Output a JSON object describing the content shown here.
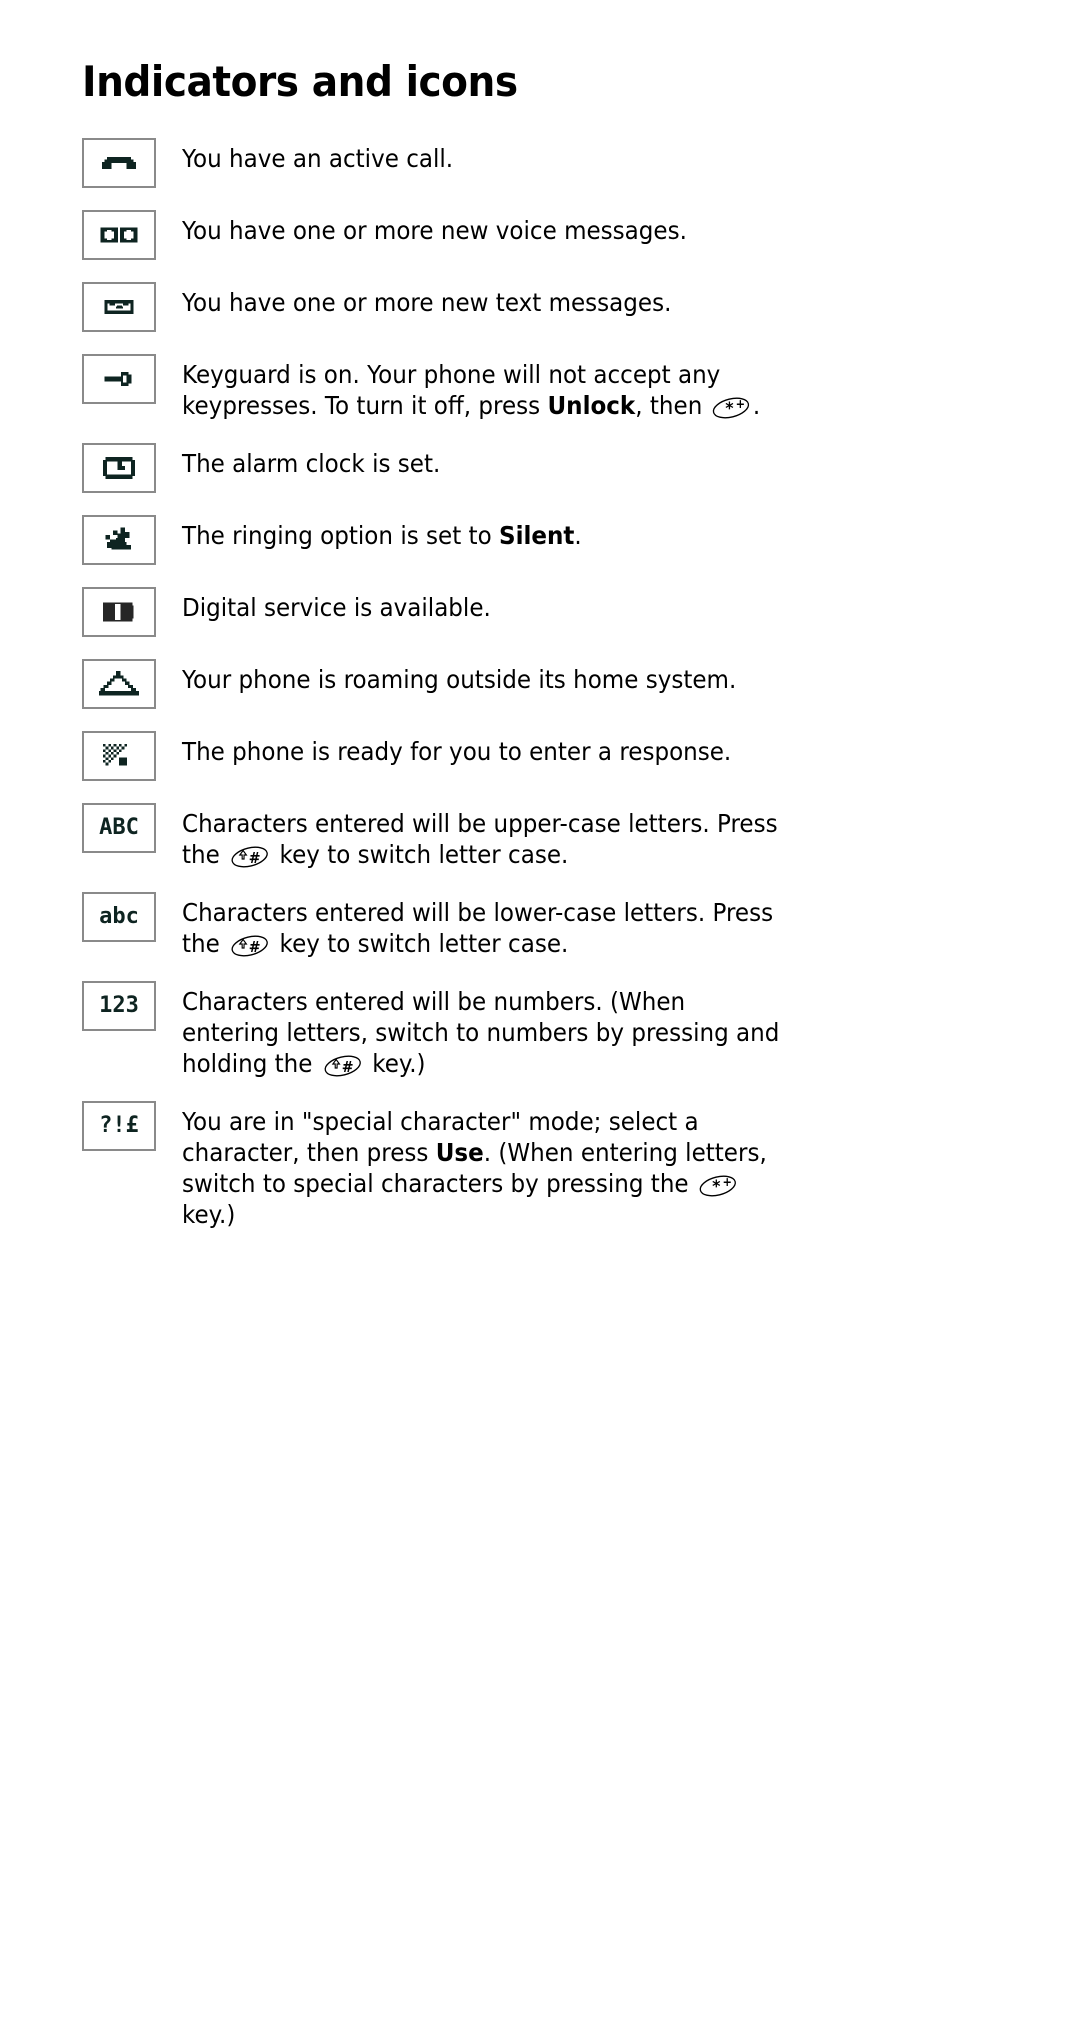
{
  "page": {
    "title": "Indicators and icons"
  },
  "glyphs": {
    "star_key": "star-plus-key-glyph",
    "hash_key": "shift-hash-key-glyph"
  },
  "rows": [
    {
      "icon_name": "active-call-icon",
      "icon_kind": "handset",
      "icon_label": "",
      "text_parts": [
        {
          "type": "text",
          "value": "You have an active call."
        }
      ]
    },
    {
      "icon_name": "voice-message-icon",
      "icon_kind": "voicemail",
      "icon_label": "",
      "text_parts": [
        {
          "type": "text",
          "value": "You have one or more new voice messages."
        }
      ]
    },
    {
      "icon_name": "text-message-icon",
      "icon_kind": "envelope",
      "icon_label": "",
      "text_parts": [
        {
          "type": "text",
          "value": "You have one or more new text messages."
        }
      ]
    },
    {
      "icon_name": "keyguard-icon",
      "icon_kind": "key",
      "icon_label": "",
      "text_parts": [
        {
          "type": "text",
          "value": "Keyguard is on. Your phone will not accept any keypresses. To turn it off, press "
        },
        {
          "type": "bold",
          "value": "Unlock"
        },
        {
          "type": "text",
          "value": ", then "
        },
        {
          "type": "glyph",
          "value": "star_key"
        },
        {
          "type": "text",
          "value": "."
        }
      ]
    },
    {
      "icon_name": "alarm-clock-icon",
      "icon_kind": "alarm",
      "icon_label": "",
      "text_parts": [
        {
          "type": "text",
          "value": "The alarm clock is set."
        }
      ]
    },
    {
      "icon_name": "silent-ringing-icon",
      "icon_kind": "silent",
      "icon_label": "",
      "text_parts": [
        {
          "type": "text",
          "value": "The ringing option is set to "
        },
        {
          "type": "bold",
          "value": "Silent"
        },
        {
          "type": "text",
          "value": "."
        }
      ]
    },
    {
      "icon_name": "digital-service-icon",
      "icon_kind": "digital",
      "icon_label": "",
      "text_parts": [
        {
          "type": "text",
          "value": "Digital service is available."
        }
      ]
    },
    {
      "icon_name": "roaming-icon",
      "icon_kind": "roaming",
      "icon_label": "",
      "text_parts": [
        {
          "type": "text",
          "value": "Your phone is roaming outside its home system."
        }
      ]
    },
    {
      "icon_name": "response-ready-icon",
      "icon_kind": "cursor",
      "icon_label": "",
      "text_parts": [
        {
          "type": "text",
          "value": "The phone is ready for you to enter a response."
        }
      ]
    },
    {
      "icon_name": "upper-case-mode-icon",
      "icon_kind": "label",
      "icon_label": "ABC",
      "text_parts": [
        {
          "type": "text",
          "value": "Characters entered will be upper-case letters. Press the "
        },
        {
          "type": "glyph",
          "value": "hash_key"
        },
        {
          "type": "text",
          "value": " key to switch letter case."
        }
      ]
    },
    {
      "icon_name": "lower-case-mode-icon",
      "icon_kind": "label",
      "icon_label": "abc",
      "text_parts": [
        {
          "type": "text",
          "value": "Characters entered will be lower-case letters. Press the "
        },
        {
          "type": "glyph",
          "value": "hash_key"
        },
        {
          "type": "text",
          "value": " key to switch letter case."
        }
      ]
    },
    {
      "icon_name": "number-mode-icon",
      "icon_kind": "label",
      "icon_label": "123",
      "text_parts": [
        {
          "type": "text",
          "value": "Characters entered will be numbers. (When entering letters, switch to numbers by pressing and holding the "
        },
        {
          "type": "glyph",
          "value": "hash_key"
        },
        {
          "type": "text",
          "value": " key.)"
        }
      ]
    },
    {
      "icon_name": "special-character-mode-icon",
      "icon_kind": "label",
      "icon_label": "?!£",
      "text_parts": [
        {
          "type": "text",
          "value": "You are in \"special character\" mode; select a character, then press "
        },
        {
          "type": "bold",
          "value": "Use"
        },
        {
          "type": "text",
          "value": ". (When entering letters, switch to special characters by pressing the "
        },
        {
          "type": "glyph",
          "value": "star_key"
        },
        {
          "type": "text",
          "value": " key.)"
        }
      ]
    }
  ]
}
